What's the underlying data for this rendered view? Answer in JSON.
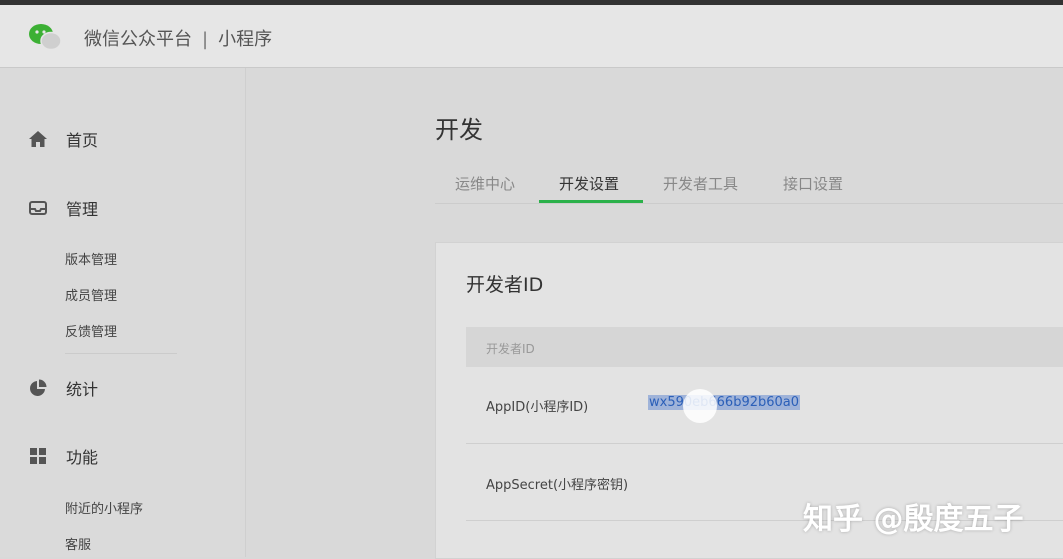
{
  "header": {
    "app_name": "微信公众平台",
    "separator": "|",
    "section": "小程序"
  },
  "sidebar": {
    "home": "首页",
    "manage": "管理",
    "manage_items": [
      "版本管理",
      "成员管理",
      "反馈管理"
    ],
    "stats": "统计",
    "features": "功能",
    "features_items": [
      "附近的小程序",
      "客服"
    ]
  },
  "main": {
    "title": "开发",
    "tabs": [
      "运维中心",
      "开发设置",
      "开发者工具",
      "接口设置"
    ],
    "active_tab": "开发设置",
    "card": {
      "title": "开发者ID",
      "table_header": "开发者ID",
      "rows": [
        {
          "label": "AppID(小程序ID)",
          "value": "wx590eb666b92b60a0"
        },
        {
          "label": "AppSecret(小程序密钥)",
          "value": ""
        }
      ]
    }
  },
  "watermark": "知乎 @殷度五子",
  "colors": {
    "accent_green": "#2bb14a",
    "selection": "#9fb3d9"
  }
}
